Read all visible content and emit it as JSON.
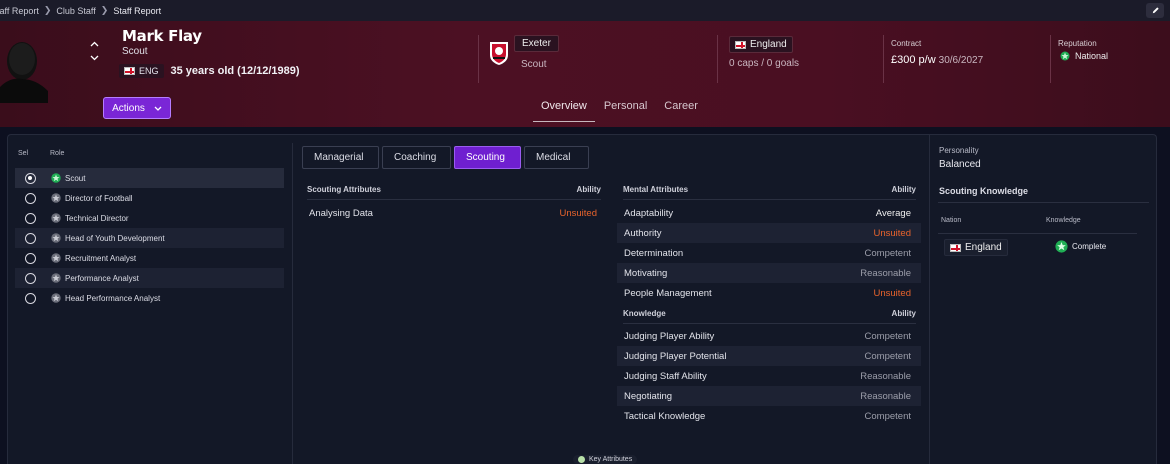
{
  "breadcrumb": {
    "items": [
      "taff Report",
      "Club Staff",
      "Staff Report"
    ]
  },
  "profile": {
    "name": "Mark Flay",
    "role": "Scout",
    "nationality_code": "ENG",
    "age_dob": "35 years old (12/12/1989)"
  },
  "club": {
    "name": "Exeter",
    "position": "Scout"
  },
  "international": {
    "nation": "England",
    "caps_goals": "0 caps / 0 goals"
  },
  "contract": {
    "label": "Contract",
    "wage": "£300 p/w",
    "expiry": "30/6/2027"
  },
  "reputation": {
    "label": "Reputation",
    "value": "National"
  },
  "actions": {
    "label": "Actions"
  },
  "profile_tabs": [
    {
      "label": "Overview",
      "active": true
    },
    {
      "label": "Personal",
      "active": false
    },
    {
      "label": "Career",
      "active": false
    }
  ],
  "roles": {
    "headers": {
      "sel": "Sel",
      "role": "Role"
    },
    "items": [
      {
        "label": "Scout",
        "selected": true
      },
      {
        "label": "Director of Football",
        "selected": false
      },
      {
        "label": "Technical Director",
        "selected": false
      },
      {
        "label": "Head of Youth Development",
        "selected": false
      },
      {
        "label": "Recruitment Analyst",
        "selected": false
      },
      {
        "label": "Performance Analyst",
        "selected": false
      },
      {
        "label": "Head Performance Analyst",
        "selected": false
      }
    ]
  },
  "section_tabs": [
    {
      "label": "Managerial",
      "active": false
    },
    {
      "label": "Coaching",
      "active": false
    },
    {
      "label": "Scouting",
      "active": true
    },
    {
      "label": "Medical",
      "active": false
    }
  ],
  "scouting_attributes": {
    "title": "Scouting Attributes",
    "ability_header": "Ability",
    "rows": [
      {
        "name": "Analysing Data",
        "value": "Unsuited"
      }
    ]
  },
  "mental_attributes": {
    "title": "Mental Attributes",
    "ability_header": "Ability",
    "rows": [
      {
        "name": "Adaptability",
        "value": "Average"
      },
      {
        "name": "Authority",
        "value": "Unsuited"
      },
      {
        "name": "Determination",
        "value": "Competent"
      },
      {
        "name": "Motivating",
        "value": "Reasonable"
      },
      {
        "name": "People Management",
        "value": "Unsuited"
      }
    ]
  },
  "knowledge": {
    "title": "Knowledge",
    "ability_header": "Ability",
    "rows": [
      {
        "name": "Judging Player Ability",
        "value": "Competent"
      },
      {
        "name": "Judging Player Potential",
        "value": "Competent"
      },
      {
        "name": "Judging Staff Ability",
        "value": "Reasonable"
      },
      {
        "name": "Negotiating",
        "value": "Reasonable"
      },
      {
        "name": "Tactical Knowledge",
        "value": "Competent"
      }
    ]
  },
  "personality": {
    "label": "Personality",
    "value": "Balanced"
  },
  "scouting_knowledge": {
    "title": "Scouting Knowledge",
    "headers": {
      "nation": "Nation",
      "knowledge": "Knowledge"
    },
    "rows": [
      {
        "nation": "England",
        "knowledge": "Complete"
      }
    ]
  },
  "footer": {
    "key_attributes": "Key Attributes"
  },
  "colors": {
    "accent": "#6f1fd0",
    "header_bg": "#4a0f22",
    "unsuited": "#e8632c",
    "page_bg": "#0d1020"
  }
}
